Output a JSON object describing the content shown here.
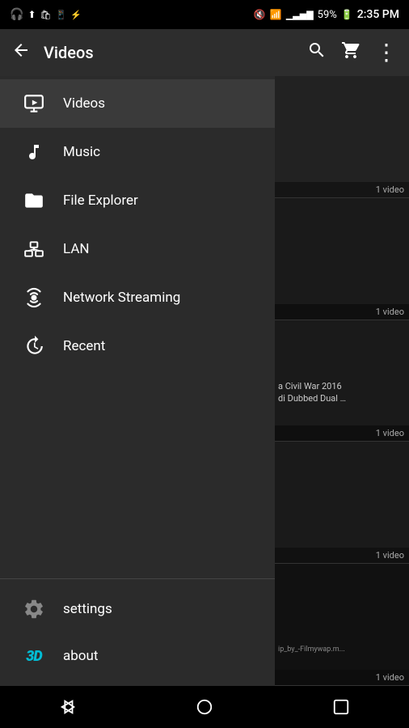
{
  "statusBar": {
    "battery": "59%",
    "time": "2:35 PM"
  },
  "appBar": {
    "title": "Videos",
    "backLabel": "←",
    "searchLabel": "🔍",
    "cartLabel": "🛒",
    "moreLabel": "⋮"
  },
  "drawer": {
    "items": [
      {
        "id": "videos",
        "label": "Videos",
        "icon": "video",
        "active": true
      },
      {
        "id": "music",
        "label": "Music",
        "icon": "music"
      },
      {
        "id": "file-explorer",
        "label": "File Explorer",
        "icon": "folder"
      },
      {
        "id": "lan",
        "label": "LAN",
        "icon": "lan"
      },
      {
        "id": "network-streaming",
        "label": "Network Streaming",
        "icon": "network"
      },
      {
        "id": "recent",
        "label": "Recent",
        "icon": "recent"
      }
    ],
    "bottomItems": [
      {
        "id": "settings",
        "label": "settings",
        "icon": "gear"
      },
      {
        "id": "about",
        "label": "about",
        "icon": "3d"
      }
    ]
  },
  "contentFolders": [
    {
      "id": "folder1",
      "count": "1 video"
    },
    {
      "id": "folder2",
      "count": "1 video"
    },
    {
      "id": "folder3",
      "count": "1 video",
      "title": "a Civil War 2016 di Dubbed Dual …"
    },
    {
      "id": "folder4",
      "count": "1 video"
    },
    {
      "id": "folder5",
      "count": "1 video",
      "subtitle": "ip_by_-Filmywap.m..."
    }
  ],
  "navBar": {
    "back": "◁",
    "home": "○",
    "recent": "□"
  }
}
